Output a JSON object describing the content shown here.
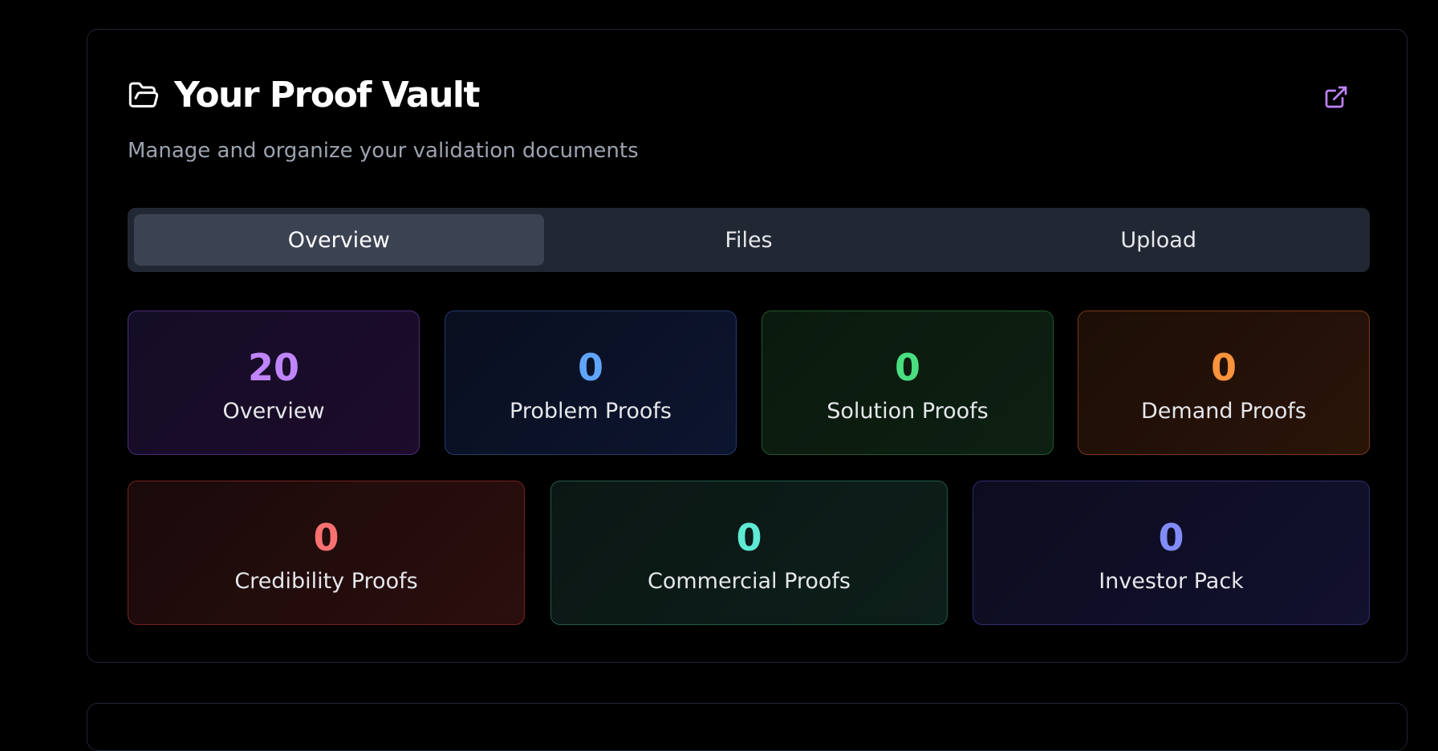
{
  "header": {
    "title": "Your Proof Vault",
    "subtitle": "Manage and organize your validation documents",
    "icon": "folder-open-icon",
    "action_icon": "external-link-icon"
  },
  "tabs": [
    {
      "label": "Overview",
      "active": true
    },
    {
      "label": "Files",
      "active": false
    },
    {
      "label": "Upload",
      "active": false
    }
  ],
  "stats": [
    {
      "value": "20",
      "label": "Overview",
      "color": "#c084fc"
    },
    {
      "value": "0",
      "label": "Problem Proofs",
      "color": "#60a5fa"
    },
    {
      "value": "0",
      "label": "Solution Proofs",
      "color": "#4ade80"
    },
    {
      "value": "0",
      "label": "Demand Proofs",
      "color": "#fb923c"
    },
    {
      "value": "0",
      "label": "Credibility Proofs",
      "color": "#f87171"
    },
    {
      "value": "0",
      "label": "Commercial Proofs",
      "color": "#5eead4"
    },
    {
      "value": "0",
      "label": "Investor Pack",
      "color": "#818cf8"
    }
  ],
  "colors": {
    "accent": "#c084fc",
    "background": "#000000",
    "tab_bar": "#222833",
    "tab_active": "#3b4252"
  }
}
